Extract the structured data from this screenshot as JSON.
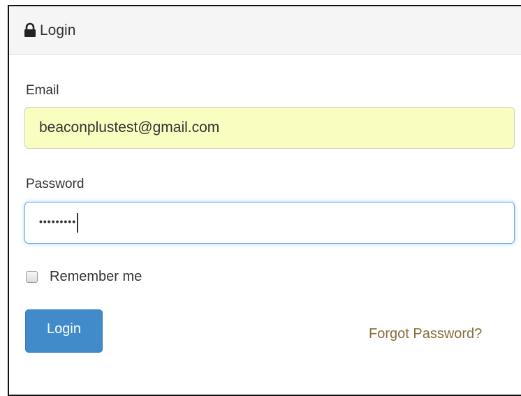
{
  "panel": {
    "title": "Login",
    "title_icon": "lock-icon"
  },
  "form": {
    "email_label": "Email",
    "email_value": "beaconplustest@gmail.com",
    "password_label": "Password",
    "password_masked": "•••••••••",
    "remember_label": "Remember me",
    "remember_checked": false,
    "login_button_label": "Login",
    "forgot_link_label": "Forgot Password?"
  },
  "colors": {
    "autofill_background": "#fafdc0",
    "focus_border": "#66afe9",
    "primary_button": "#428bca",
    "link_color": "#8a6d3b",
    "heading_background": "#f5f5f5"
  }
}
